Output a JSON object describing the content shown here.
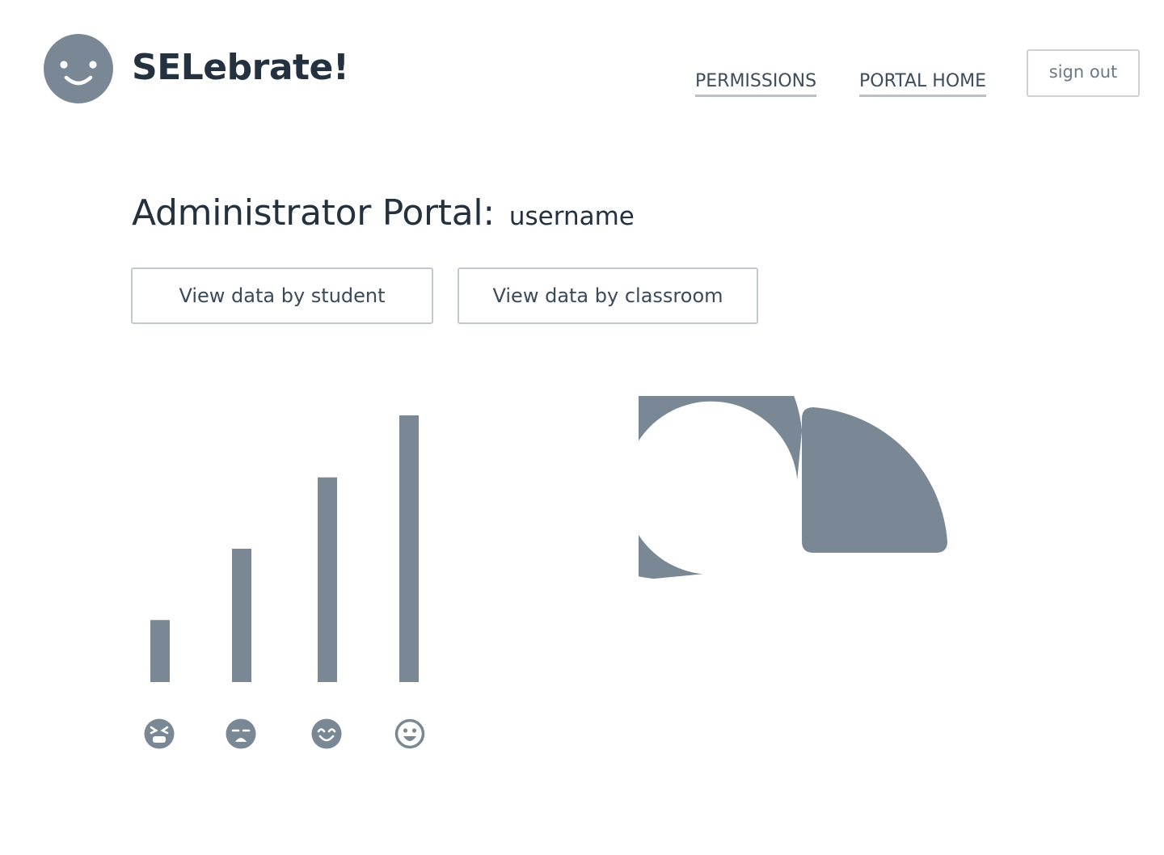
{
  "header": {
    "brand": "SELebrate!",
    "logo_icon": "smiley-face-icon",
    "nav": [
      {
        "label": "PERMISSIONS"
      },
      {
        "label": "PORTAL HOME"
      }
    ],
    "sign_out_label": "sign out"
  },
  "main": {
    "title": "Administrator Portal:",
    "username": "username",
    "buttons": {
      "by_student": "View data by student",
      "by_classroom": "View data by classroom"
    }
  },
  "colors": {
    "chart_fill": "#7a8896",
    "text_dark": "#24313f",
    "border": "#c3c8ce"
  },
  "chart_data": [
    {
      "type": "bar",
      "categories": [
        "angry-face-icon",
        "frowning-face-icon",
        "smiling-face-icon",
        "grinning-face-icon"
      ],
      "values": [
        1,
        2.15,
        3.3,
        4.3
      ],
      "ylim": [
        0,
        4.3
      ],
      "grid": false,
      "title": "",
      "xlabel": "",
      "ylabel": ""
    },
    {
      "type": "pie",
      "slices": [
        {
          "value": 25,
          "style": "exploded-solid"
        },
        {
          "value": 75,
          "style": "donut-ring"
        }
      ],
      "title": ""
    }
  ]
}
